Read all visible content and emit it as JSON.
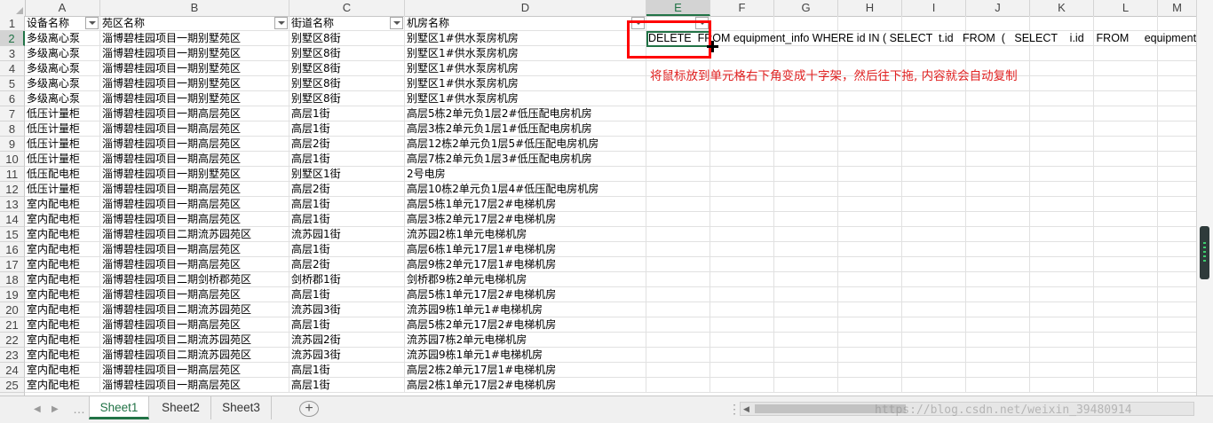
{
  "columns": [
    "A",
    "B",
    "C",
    "D",
    "E",
    "F",
    "G",
    "H",
    "I",
    "J",
    "K",
    "L",
    "M"
  ],
  "selected_column": "E",
  "selected_row": 2,
  "header_row": {
    "row": "1",
    "cells": [
      "设备名称",
      "苑区名称",
      "街道名称",
      "机房名称"
    ]
  },
  "rows": [
    {
      "row": "2",
      "cells": [
        "多级离心泵",
        "淄博碧桂园项目一期别墅苑区",
        "别墅区8街",
        "别墅区1#供水泵房机房"
      ]
    },
    {
      "row": "3",
      "cells": [
        "多级离心泵",
        "淄博碧桂园项目一期别墅苑区",
        "别墅区8街",
        "别墅区1#供水泵房机房"
      ]
    },
    {
      "row": "4",
      "cells": [
        "多级离心泵",
        "淄博碧桂园项目一期别墅苑区",
        "别墅区8街",
        "别墅区1#供水泵房机房"
      ]
    },
    {
      "row": "5",
      "cells": [
        "多级离心泵",
        "淄博碧桂园项目一期别墅苑区",
        "别墅区8街",
        "别墅区1#供水泵房机房"
      ]
    },
    {
      "row": "6",
      "cells": [
        "多级离心泵",
        "淄博碧桂园项目一期别墅苑区",
        "别墅区8街",
        "别墅区1#供水泵房机房"
      ]
    },
    {
      "row": "7",
      "cells": [
        "低压计量柜",
        "淄博碧桂园项目一期高层苑区",
        "高层1街",
        "高层5栋2单元负1层2#低压配电房机房"
      ]
    },
    {
      "row": "8",
      "cells": [
        "低压计量柜",
        "淄博碧桂园项目一期高层苑区",
        "高层1街",
        "高层3栋2单元负1层1#低压配电房机房"
      ]
    },
    {
      "row": "9",
      "cells": [
        "低压计量柜",
        "淄博碧桂园项目一期高层苑区",
        "高层2街",
        "高层12栋2单元负1层5#低压配电房机房"
      ]
    },
    {
      "row": "10",
      "cells": [
        "低压计量柜",
        "淄博碧桂园项目一期高层苑区",
        "高层1街",
        "高层7栋2单元负1层3#低压配电房机房"
      ]
    },
    {
      "row": "11",
      "cells": [
        "低压配电柜",
        "淄博碧桂园项目一期别墅苑区",
        "别墅区1街",
        "2号电房"
      ]
    },
    {
      "row": "12",
      "cells": [
        "低压计量柜",
        "淄博碧桂园项目一期高层苑区",
        "高层2街",
        "高层10栋2单元负1层4#低压配电房机房"
      ]
    },
    {
      "row": "13",
      "cells": [
        "室内配电柜",
        "淄博碧桂园项目一期高层苑区",
        "高层1街",
        "高层5栋1单元17层2#电梯机房"
      ]
    },
    {
      "row": "14",
      "cells": [
        "室内配电柜",
        "淄博碧桂园项目一期高层苑区",
        "高层1街",
        "高层3栋2单元17层2#电梯机房"
      ]
    },
    {
      "row": "15",
      "cells": [
        "室内配电柜",
        "淄博碧桂园项目二期流苏园苑区",
        "流苏园1街",
        "流苏园2栋1单元电梯机房"
      ]
    },
    {
      "row": "16",
      "cells": [
        "室内配电柜",
        "淄博碧桂园项目一期高层苑区",
        "高层1街",
        "高层6栋1单元17层1#电梯机房"
      ]
    },
    {
      "row": "17",
      "cells": [
        "室内配电柜",
        "淄博碧桂园项目一期高层苑区",
        "高层2街",
        "高层9栋2单元17层1#电梯机房"
      ]
    },
    {
      "row": "18",
      "cells": [
        "室内配电柜",
        "淄博碧桂园项目二期剑桥郡苑区",
        "剑桥郡1街",
        "剑桥郡9栋2单元电梯机房"
      ]
    },
    {
      "row": "19",
      "cells": [
        "室内配电柜",
        "淄博碧桂园项目一期高层苑区",
        "高层1街",
        "高层5栋1单元17层2#电梯机房"
      ]
    },
    {
      "row": "20",
      "cells": [
        "室内配电柜",
        "淄博碧桂园项目二期流苏园苑区",
        "流苏园3街",
        "流苏园9栋1单元1#电梯机房"
      ]
    },
    {
      "row": "21",
      "cells": [
        "室内配电柜",
        "淄博碧桂园项目一期高层苑区",
        "高层1街",
        "高层5栋2单元17层2#电梯机房"
      ]
    },
    {
      "row": "22",
      "cells": [
        "室内配电柜",
        "淄博碧桂园项目二期流苏园苑区",
        "流苏园2街",
        "流苏园7栋2单元电梯机房"
      ]
    },
    {
      "row": "23",
      "cells": [
        "室内配电柜",
        "淄博碧桂园项目二期流苏园苑区",
        "流苏园3街",
        "流苏园9栋1单元1#电梯机房"
      ]
    },
    {
      "row": "24",
      "cells": [
        "室内配电柜",
        "淄博碧桂园项目一期高层苑区",
        "高层1街",
        "高层2栋2单元17层1#电梯机房"
      ]
    },
    {
      "row": "25",
      "cells": [
        "室内配电柜",
        "淄博碧桂园项目一期高层苑区",
        "高层1街",
        "高层2栋1单元17层2#电梯机房"
      ]
    }
  ],
  "active_cell_text": "DELETE  FROM equipment_info WHERE id IN ( SELECT  t.id   FROM  (   SELECT    i.id    FROM     equipment_info",
  "annotation": "将鼠标放到单元格右下角变成十字架，然后往下拖, 内容就会自动复制",
  "sheet_tabs": [
    {
      "label": "Sheet1",
      "active": true
    },
    {
      "label": "Sheet2",
      "active": false
    },
    {
      "label": "Sheet3",
      "active": false
    }
  ],
  "add_sheet_icon": "plus-circle-icon",
  "watermark": "https://blog.csdn.net/weixin_39480914",
  "colors": {
    "accent": "#217346",
    "annotation": "#e02020",
    "highlight_box": "#ff0000"
  }
}
